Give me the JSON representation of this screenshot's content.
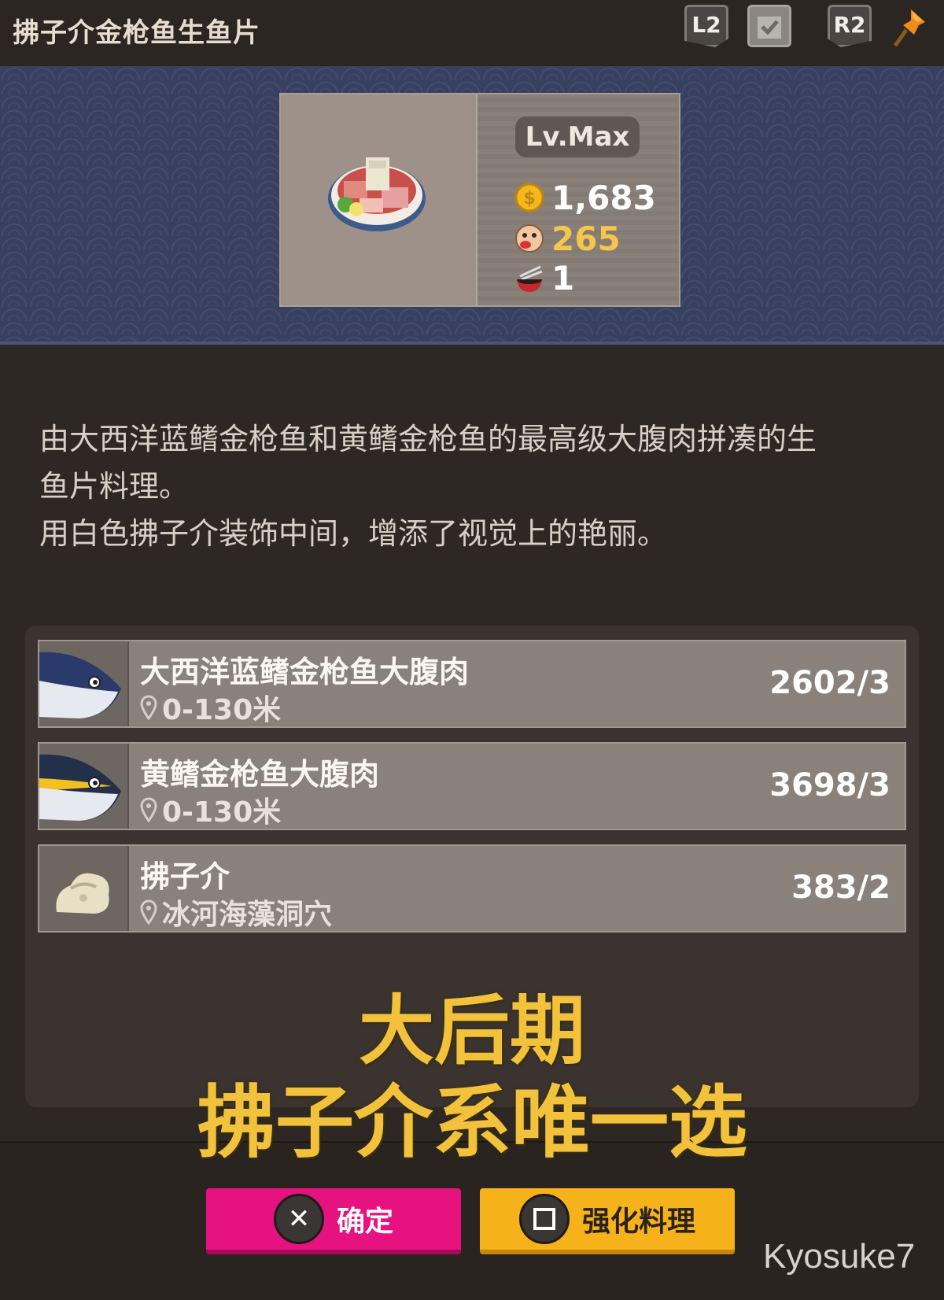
{
  "header": {
    "title": "拂子介金枪鱼生鱼片",
    "l2_label": "L2",
    "r2_label": "R2",
    "icons": [
      "clipboard-check-icon",
      "pushpin-icon"
    ]
  },
  "dish": {
    "level": "Lv.Max",
    "price": "1,683",
    "popularity": "265",
    "portions": "1"
  },
  "description": {
    "line1": "由大西洋蓝鳍金枪鱼和黄鳍金枪鱼的最高级大腹肉拼凑的生",
    "line2": "鱼片料理。",
    "line3": "用白色拂子介装饰中间，增添了视觉上的艳丽。"
  },
  "ingredients": [
    {
      "name": "大西洋蓝鳍金枪鱼大腹肉",
      "location": "0-130米",
      "quantity": "2602/3"
    },
    {
      "name": "黄鳍金枪鱼大腹肉",
      "location": "0-130米",
      "quantity": "3698/3"
    },
    {
      "name": "拂子介",
      "location": "冰河海藻洞穴",
      "quantity": "383/2"
    }
  ],
  "caption": {
    "line1": "大后期",
    "line2": "拂子介系唯一选"
  },
  "buttons": {
    "confirm": "确定",
    "enhance": "强化料理"
  },
  "watermark": "Kyosuke7",
  "colors": {
    "banner": "#384060",
    "confirm_button": "#e6127f",
    "enhance_button": "#f5b21a",
    "caption": "#f2c23c",
    "popularity": "#f5c64a"
  }
}
